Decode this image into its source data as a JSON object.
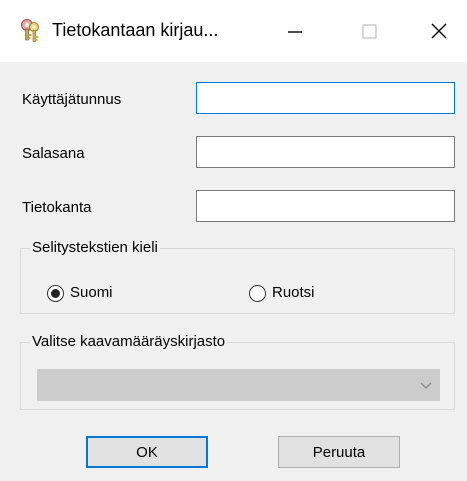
{
  "window": {
    "title": "Tietokantaan kirjau...",
    "icon": "keys-icon",
    "controls": [
      "minimize-icon",
      "maximize-icon",
      "close-icon"
    ]
  },
  "form": {
    "username": {
      "label": "Käyttäjätunnus",
      "value": "",
      "focused": true
    },
    "password": {
      "label": "Salasana",
      "value": ""
    },
    "database": {
      "label": "Tietokanta",
      "value": ""
    }
  },
  "caption_language": {
    "legend": "Selitystekstien kieli",
    "options": [
      {
        "label": "Suomi",
        "selected": true
      },
      {
        "label": "Ruotsi",
        "selected": false
      }
    ]
  },
  "formula_library": {
    "legend": "Valitse kaavamääräyskirjasto",
    "selected_value": "",
    "enabled": false
  },
  "buttons": {
    "ok": "OK",
    "cancel": "Peruuta"
  },
  "colors": {
    "focus_accent": "#0078d7",
    "dialog_background": "#f0f0f0",
    "disabled_field": "#cccccc"
  }
}
